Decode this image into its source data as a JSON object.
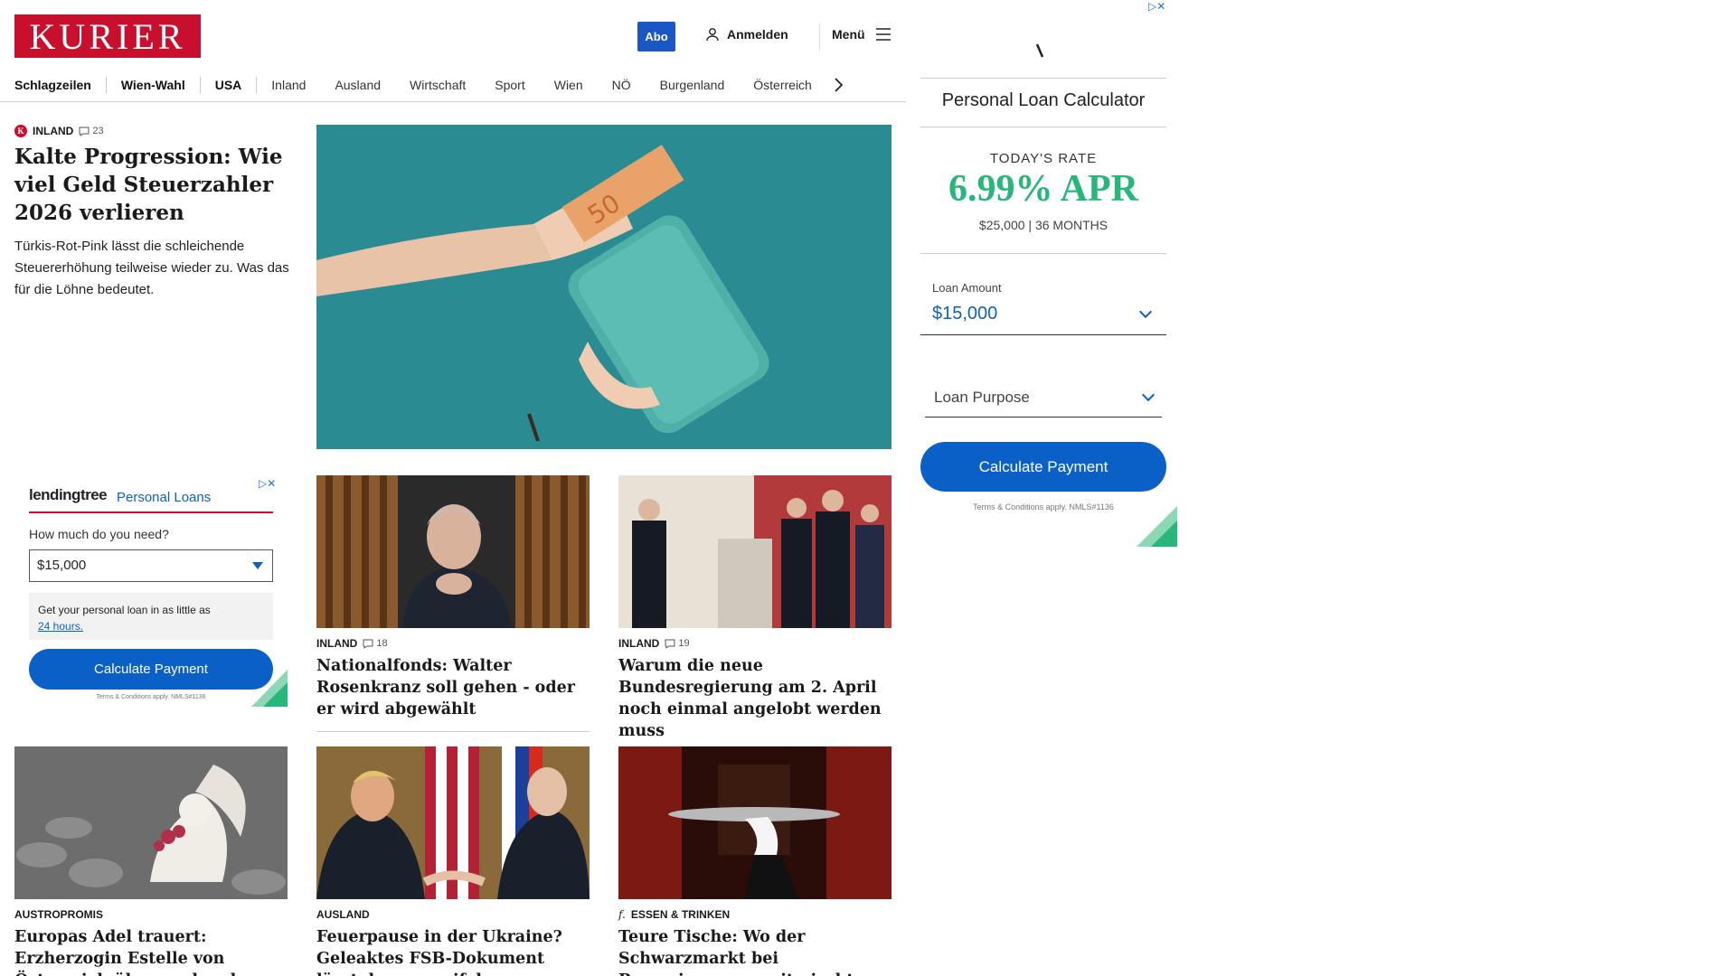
{
  "header": {
    "logo": "KURIER",
    "abo_label": "Abo",
    "login_label": "Anmelden",
    "menu_label": "Menü"
  },
  "nav": {
    "items": [
      "Schlagzeilen",
      "Wien-Wahl",
      "USA",
      "Inland",
      "Ausland",
      "Wirtschaft",
      "Sport",
      "Wien",
      "NÖ",
      "Burgenland",
      "Österreich"
    ]
  },
  "lead": {
    "category": "INLAND",
    "comments": "23",
    "title": "Kalte Progression: Wie viel Geld Steuerzahler 2026 verlieren",
    "teaser": "Türkis-Rot-Pink lässt die schleichende Steuererhöhung teilweise wieder zu. Was das für die Löhne bedeutet."
  },
  "stories": [
    {
      "category": "INLAND",
      "comments": "18",
      "title": "Nationalfonds: Walter Rosenkranz soll gehen - oder er wird abgewählt"
    },
    {
      "category": "INLAND",
      "comments": "19",
      "title": "Warum die neue Bundesregierung am 2. April noch einmal angelobt werden muss"
    },
    {
      "category": "AUSTROPROMIS",
      "comments": "",
      "title": "Europas Adel trauert: Erzherzogin Estelle von Österreich überraschend verstorben"
    },
    {
      "category": "AUSLAND",
      "comments": "",
      "title": "Feuerpause in der Ukraine? Geleaktes FSB-Dokument lässt daran zweifeln"
    },
    {
      "category": "ESSEN & TRINKEN",
      "comments": "",
      "title": "Teure Tische: Wo der Schwarzmarkt bei Reservierungen mitmischt"
    }
  ],
  "ad_left": {
    "brand": "lendingtree",
    "product": "Personal Loans",
    "question": "How much do you need?",
    "selected": "$15,000",
    "info_text": "Get your personal loan in as little as",
    "info_link": "24 hours.",
    "button": "Calculate Payment",
    "terms": "Terms & Conditions apply. NMLS#1136"
  },
  "ad_right": {
    "title": "Personal Loan Calculator",
    "today_label": "TODAY'S RATE",
    "rate": "6.99% APR",
    "terms_line": "$25,000 | 36 MONTHS",
    "amount_label": "Loan Amount",
    "amount_value": "$15,000",
    "purpose_placeholder": "Loan Purpose",
    "button": "Calculate Payment",
    "terms": "Terms & Conditions apply. NMLS#1136"
  },
  "colors": {
    "brand_red": "#c8102e",
    "abo_blue": "#1a56c4",
    "ad_blue": "#0b60c8",
    "rate_green": "#28b67a"
  }
}
